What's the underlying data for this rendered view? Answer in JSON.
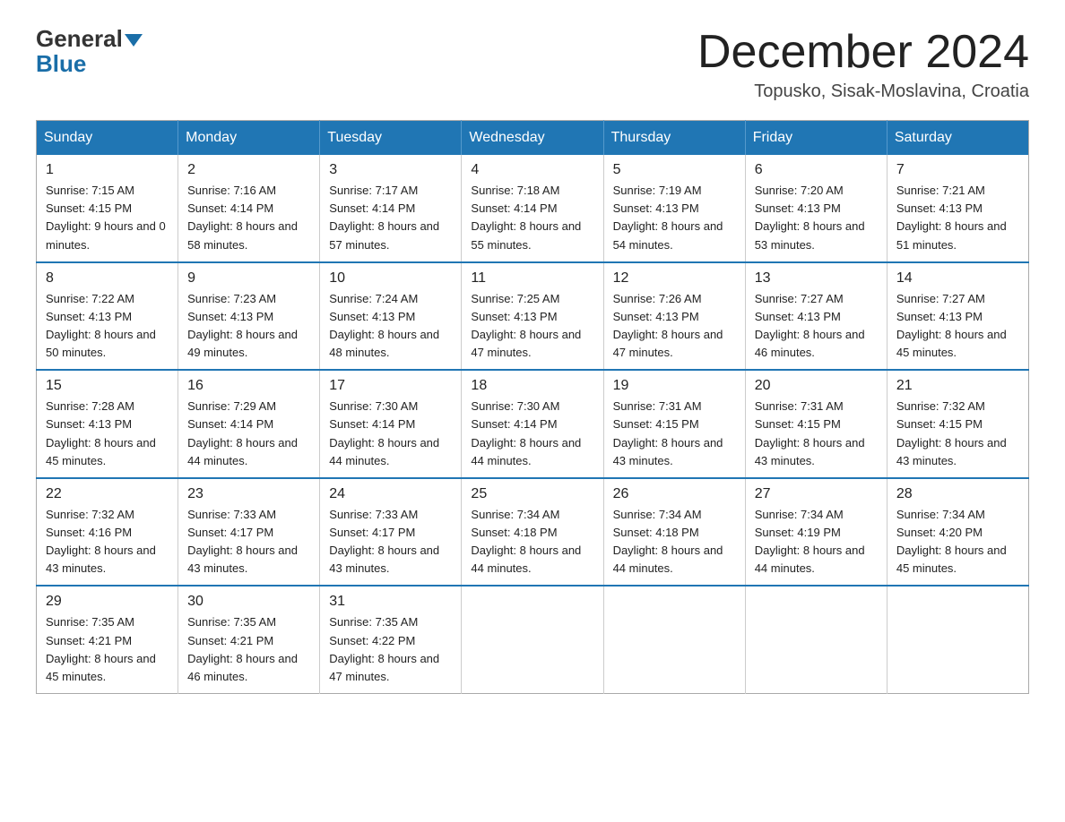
{
  "header": {
    "logo_general": "General",
    "logo_blue": "Blue",
    "month_title": "December 2024",
    "location": "Topusko, Sisak-Moslavina, Croatia"
  },
  "days_of_week": [
    "Sunday",
    "Monday",
    "Tuesday",
    "Wednesday",
    "Thursday",
    "Friday",
    "Saturday"
  ],
  "weeks": [
    [
      {
        "day": "1",
        "sunrise": "7:15 AM",
        "sunset": "4:15 PM",
        "daylight": "9 hours and 0 minutes."
      },
      {
        "day": "2",
        "sunrise": "7:16 AM",
        "sunset": "4:14 PM",
        "daylight": "8 hours and 58 minutes."
      },
      {
        "day": "3",
        "sunrise": "7:17 AM",
        "sunset": "4:14 PM",
        "daylight": "8 hours and 57 minutes."
      },
      {
        "day": "4",
        "sunrise": "7:18 AM",
        "sunset": "4:14 PM",
        "daylight": "8 hours and 55 minutes."
      },
      {
        "day": "5",
        "sunrise": "7:19 AM",
        "sunset": "4:13 PM",
        "daylight": "8 hours and 54 minutes."
      },
      {
        "day": "6",
        "sunrise": "7:20 AM",
        "sunset": "4:13 PM",
        "daylight": "8 hours and 53 minutes."
      },
      {
        "day": "7",
        "sunrise": "7:21 AM",
        "sunset": "4:13 PM",
        "daylight": "8 hours and 51 minutes."
      }
    ],
    [
      {
        "day": "8",
        "sunrise": "7:22 AM",
        "sunset": "4:13 PM",
        "daylight": "8 hours and 50 minutes."
      },
      {
        "day": "9",
        "sunrise": "7:23 AM",
        "sunset": "4:13 PM",
        "daylight": "8 hours and 49 minutes."
      },
      {
        "day": "10",
        "sunrise": "7:24 AM",
        "sunset": "4:13 PM",
        "daylight": "8 hours and 48 minutes."
      },
      {
        "day": "11",
        "sunrise": "7:25 AM",
        "sunset": "4:13 PM",
        "daylight": "8 hours and 47 minutes."
      },
      {
        "day": "12",
        "sunrise": "7:26 AM",
        "sunset": "4:13 PM",
        "daylight": "8 hours and 47 minutes."
      },
      {
        "day": "13",
        "sunrise": "7:27 AM",
        "sunset": "4:13 PM",
        "daylight": "8 hours and 46 minutes."
      },
      {
        "day": "14",
        "sunrise": "7:27 AM",
        "sunset": "4:13 PM",
        "daylight": "8 hours and 45 minutes."
      }
    ],
    [
      {
        "day": "15",
        "sunrise": "7:28 AM",
        "sunset": "4:13 PM",
        "daylight": "8 hours and 45 minutes."
      },
      {
        "day": "16",
        "sunrise": "7:29 AM",
        "sunset": "4:14 PM",
        "daylight": "8 hours and 44 minutes."
      },
      {
        "day": "17",
        "sunrise": "7:30 AM",
        "sunset": "4:14 PM",
        "daylight": "8 hours and 44 minutes."
      },
      {
        "day": "18",
        "sunrise": "7:30 AM",
        "sunset": "4:14 PM",
        "daylight": "8 hours and 44 minutes."
      },
      {
        "day": "19",
        "sunrise": "7:31 AM",
        "sunset": "4:15 PM",
        "daylight": "8 hours and 43 minutes."
      },
      {
        "day": "20",
        "sunrise": "7:31 AM",
        "sunset": "4:15 PM",
        "daylight": "8 hours and 43 minutes."
      },
      {
        "day": "21",
        "sunrise": "7:32 AM",
        "sunset": "4:15 PM",
        "daylight": "8 hours and 43 minutes."
      }
    ],
    [
      {
        "day": "22",
        "sunrise": "7:32 AM",
        "sunset": "4:16 PM",
        "daylight": "8 hours and 43 minutes."
      },
      {
        "day": "23",
        "sunrise": "7:33 AM",
        "sunset": "4:17 PM",
        "daylight": "8 hours and 43 minutes."
      },
      {
        "day": "24",
        "sunrise": "7:33 AM",
        "sunset": "4:17 PM",
        "daylight": "8 hours and 43 minutes."
      },
      {
        "day": "25",
        "sunrise": "7:34 AM",
        "sunset": "4:18 PM",
        "daylight": "8 hours and 44 minutes."
      },
      {
        "day": "26",
        "sunrise": "7:34 AM",
        "sunset": "4:18 PM",
        "daylight": "8 hours and 44 minutes."
      },
      {
        "day": "27",
        "sunrise": "7:34 AM",
        "sunset": "4:19 PM",
        "daylight": "8 hours and 44 minutes."
      },
      {
        "day": "28",
        "sunrise": "7:34 AM",
        "sunset": "4:20 PM",
        "daylight": "8 hours and 45 minutes."
      }
    ],
    [
      {
        "day": "29",
        "sunrise": "7:35 AM",
        "sunset": "4:21 PM",
        "daylight": "8 hours and 45 minutes."
      },
      {
        "day": "30",
        "sunrise": "7:35 AM",
        "sunset": "4:21 PM",
        "daylight": "8 hours and 46 minutes."
      },
      {
        "day": "31",
        "sunrise": "7:35 AM",
        "sunset": "4:22 PM",
        "daylight": "8 hours and 47 minutes."
      },
      null,
      null,
      null,
      null
    ]
  ]
}
